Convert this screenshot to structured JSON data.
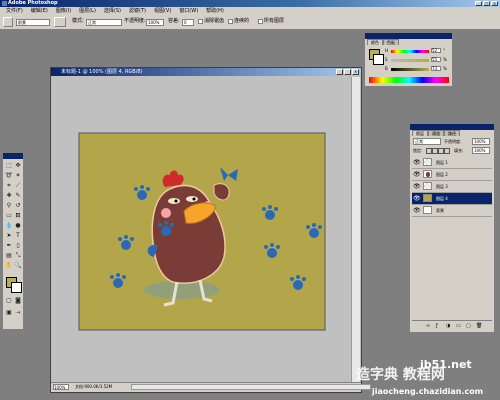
{
  "app": {
    "title": "Adobe Photoshop"
  },
  "menu": {
    "items": [
      "文件(F)",
      "编辑(E)",
      "图像(I)",
      "图层(L)",
      "选择(S)",
      "滤镜(T)",
      "视图(V)",
      "窗口(W)",
      "帮助(H)"
    ]
  },
  "options": {
    "mode_label": "模式:",
    "mode_value": "正常",
    "opacity_label": "不透明度:",
    "opacity_value": "100%",
    "tolerance_label": "容差:",
    "tolerance_value": "0",
    "antialias_label": "消除锯齿",
    "contiguous_label": "连续的",
    "all_layers_label": "所有图层",
    "preset_value": "前景"
  },
  "document": {
    "title": "未标题-1 @ 100% (图层 4, RGB/8)",
    "zoom": "100%",
    "doc_info": "文档:900.0K/3.52M"
  },
  "color_panel": {
    "tab_color": "颜色",
    "tab_swatches": "色板",
    "rows": [
      {
        "label": "H",
        "value": "52",
        "unit": "°"
      },
      {
        "label": "S",
        "value": "55",
        "unit": "%"
      },
      {
        "label": "B",
        "value": "73",
        "unit": "%"
      }
    ],
    "foreground_color": "#bbad55"
  },
  "layers_panel": {
    "tab_layers": "图层",
    "tab_channels": "通道",
    "tab_paths": "路径",
    "blend_mode": "正常",
    "opacity_label": "不透明度:",
    "opacity_value": "100%",
    "lock_label": "锁定:",
    "fill_label": "填充:",
    "fill_value": "100%",
    "layers": [
      {
        "name": "图层 1",
        "selected": false
      },
      {
        "name": "图层 2",
        "selected": false
      },
      {
        "name": "图层 3",
        "selected": false
      },
      {
        "name": "图层 4",
        "selected": true
      },
      {
        "name": "背景",
        "selected": false
      }
    ]
  },
  "artwork": {
    "background_color": "#b3a64a",
    "character_color": "#7a3c36",
    "paw_color": "#2a6ab4"
  },
  "watermark": {
    "site": "jb51.net",
    "url": "jiaocheng.chazidian.com",
    "cn": "造字典 教程网"
  }
}
